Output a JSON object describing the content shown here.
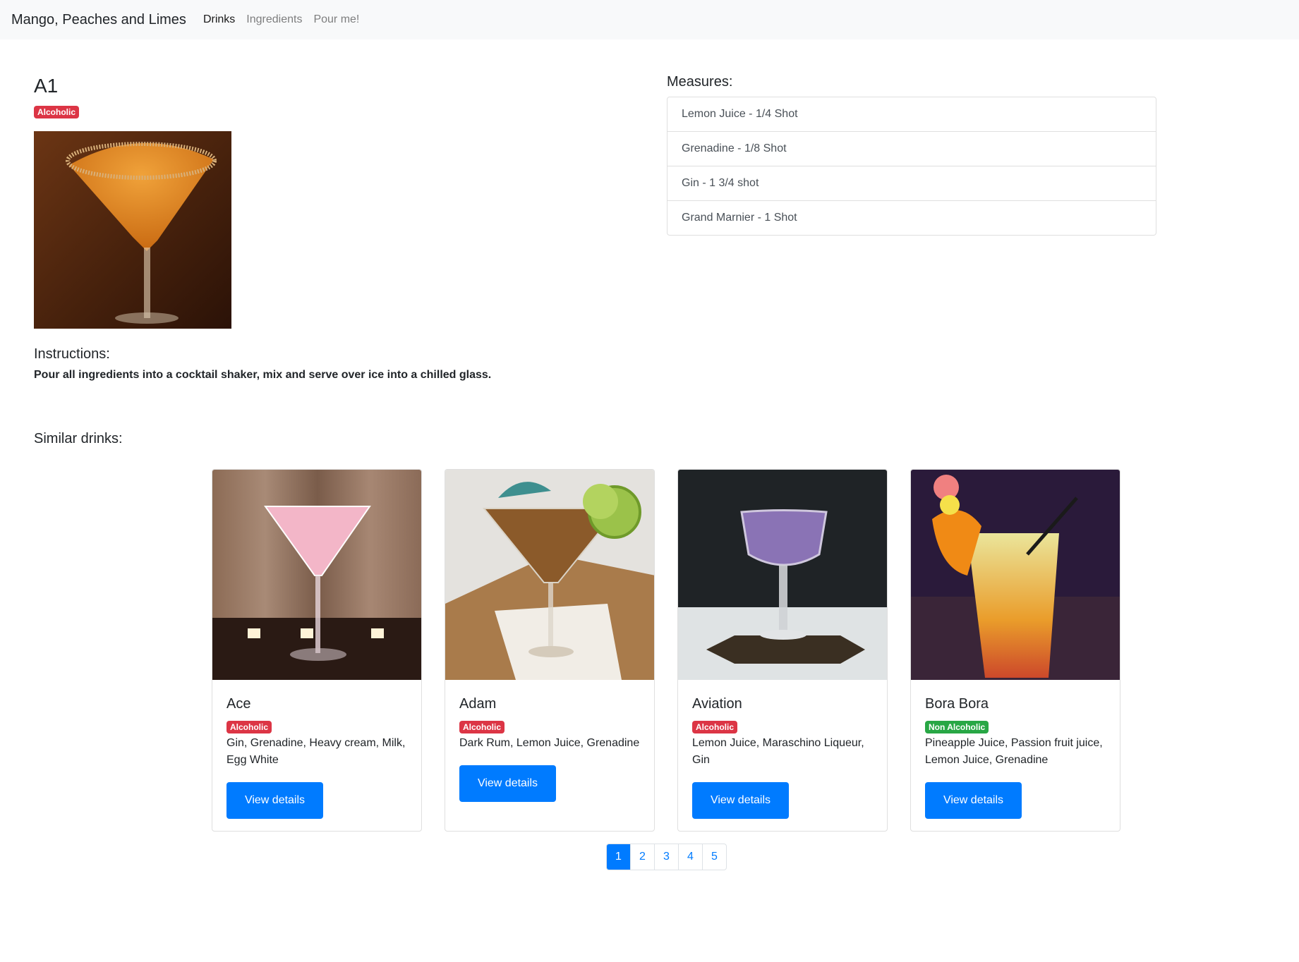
{
  "navbar": {
    "brand": "Mango, Peaches and Limes",
    "links": [
      {
        "label": "Drinks",
        "active": true
      },
      {
        "label": "Ingredients",
        "active": false
      },
      {
        "label": "Pour me!",
        "active": false
      }
    ]
  },
  "drink": {
    "name": "A1",
    "badge": "Alcoholic",
    "image_icon": "orange-martini-image"
  },
  "instructions": {
    "heading": "Instructions:",
    "text": "Pour all ingredients into a cocktail shaker, mix and serve over ice into a chilled glass."
  },
  "measures": {
    "heading": "Measures:",
    "items": [
      "Lemon Juice - 1/4 Shot",
      "Grenadine - 1/8 Shot",
      "Gin - 1 3/4 shot",
      "Grand Marnier - 1 Shot"
    ]
  },
  "similar": {
    "heading": "Similar drinks:",
    "cards": [
      {
        "name": "Ace",
        "badge": "Alcoholic",
        "ingredients": "Gin, Grenadine, Heavy cream, Milk, Egg White",
        "button": "View details"
      },
      {
        "name": "Adam",
        "badge": "Alcoholic",
        "ingredients": "Dark Rum, Lemon Juice, Grenadine",
        "button": "View details"
      },
      {
        "name": "Aviation",
        "badge": "Alcoholic",
        "ingredients": "Lemon Juice, Maraschino Liqueur, Gin",
        "button": "View details"
      },
      {
        "name": "Bora Bora",
        "badge": "Non Alcoholic",
        "ingredients": "Pineapple Juice, Passion fruit juice, Lemon Juice, Grenadine",
        "button": "View details"
      }
    ]
  },
  "pagination": {
    "pages": [
      "1",
      "2",
      "3",
      "4",
      "5"
    ],
    "current": "1"
  },
  "colors": {
    "primary": "#007bff",
    "danger": "#dc3545",
    "success": "#28a745",
    "navbar_bg": "#f8f9fa"
  }
}
